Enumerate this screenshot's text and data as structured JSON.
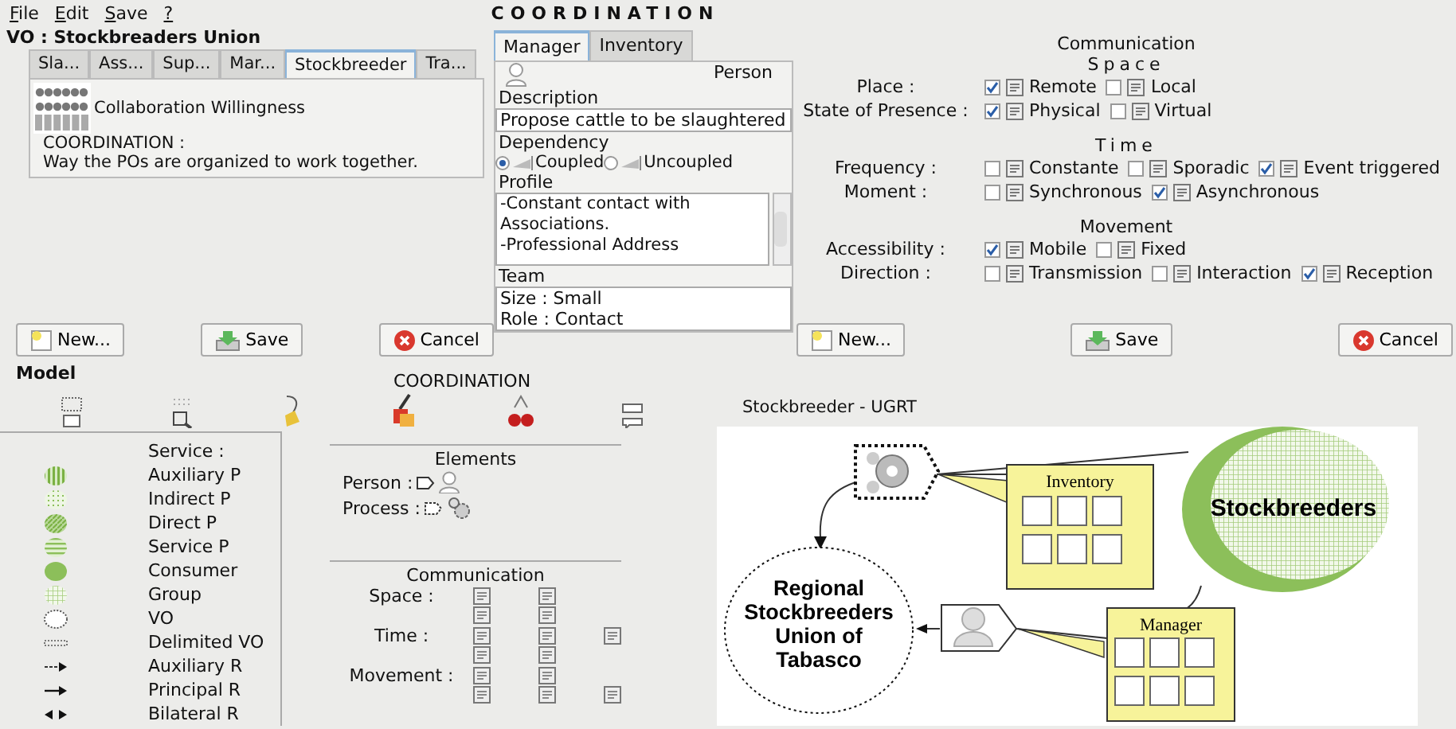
{
  "menu": [
    "File",
    "Edit",
    "Save",
    "?"
  ],
  "header_title": "COORDINATION",
  "vo_title": "VO : Stockbreaders Union",
  "vo_tabs": [
    {
      "label": "Sla...",
      "selected": false
    },
    {
      "label": "Ass...",
      "selected": false
    },
    {
      "label": "Sup...",
      "selected": false
    },
    {
      "label": "Mar...",
      "selected": false
    },
    {
      "label": "Stockbreeder",
      "selected": true
    },
    {
      "label": "Tra...",
      "selected": false
    }
  ],
  "aspect": {
    "title": "Collaboration Willingness",
    "heading": "COORDINATION :",
    "text": "Way the POs are organized to work together."
  },
  "left_buttons": [
    {
      "label": "New...",
      "kind": "new"
    },
    {
      "label": "Save",
      "kind": "save"
    },
    {
      "label": "Cancel",
      "kind": "cancel"
    }
  ],
  "role_tabs": [
    {
      "label": "Manager",
      "selected": true
    },
    {
      "label": "Inventory",
      "selected": false
    }
  ],
  "element_type": "Person",
  "description": {
    "label": "Description",
    "value": "Propose cattle to be slaughtered"
  },
  "dependency": {
    "label": "Dependency",
    "options": [
      {
        "label": "Coupled",
        "selected": true
      },
      {
        "label": "Uncoupled",
        "selected": false
      }
    ]
  },
  "profile": {
    "label": "Profile",
    "value": "-Constant contact with Associations.\n-Professional Address"
  },
  "team": {
    "label": "Team",
    "lines": [
      "Size : Small",
      "Role : Contact"
    ]
  },
  "communication": {
    "title": "Communication",
    "groups": [
      {
        "title": "Space",
        "spaced": true,
        "rows": [
          {
            "label": "Place :",
            "options": [
              {
                "label": "Remote",
                "checked": true
              },
              {
                "label": "Local",
                "checked": false
              }
            ]
          },
          {
            "label": "State of Presence :",
            "options": [
              {
                "label": "Physical",
                "checked": true
              },
              {
                "label": "Virtual",
                "checked": false
              }
            ]
          }
        ]
      },
      {
        "title": "Time",
        "spaced": true,
        "rows": [
          {
            "label": "Frequency :",
            "options": [
              {
                "label": "Constante",
                "checked": false
              },
              {
                "label": "Sporadic",
                "checked": false
              },
              {
                "label": "Event triggered",
                "checked": true
              }
            ]
          },
          {
            "label": "Moment :",
            "options": [
              {
                "label": "Synchronous",
                "checked": false
              },
              {
                "label": "Asynchronous",
                "checked": true
              }
            ]
          }
        ]
      },
      {
        "title": "Movement",
        "spaced": false,
        "rows": [
          {
            "label": "Accessibility :",
            "options": [
              {
                "label": "Mobile",
                "checked": true
              },
              {
                "label": "Fixed",
                "checked": false
              }
            ]
          },
          {
            "label": "Direction :",
            "options": [
              {
                "label": "Transmission",
                "checked": false
              },
              {
                "label": "Interaction",
                "checked": false
              },
              {
                "label": "Reception",
                "checked": true
              }
            ]
          }
        ]
      }
    ]
  },
  "right_buttons": [
    {
      "label": "New...",
      "kind": "new"
    },
    {
      "label": "Save",
      "kind": "save"
    },
    {
      "label": "Cancel",
      "kind": "cancel"
    }
  ],
  "model": {
    "title": "Model",
    "coordination_label": "COORDINATION",
    "legend_heading": "Service :",
    "legend": [
      {
        "label": "Auxiliary P",
        "kind": "vstripe"
      },
      {
        "label": "Indirect P",
        "kind": "dotted"
      },
      {
        "label": "Direct P",
        "kind": "diagonal"
      },
      {
        "label": "Service P",
        "kind": "hstripe"
      },
      {
        "label": "Consumer",
        "kind": "solid"
      },
      {
        "label": "Group",
        "kind": "grid"
      },
      {
        "label": "VO",
        "kind": "vo"
      },
      {
        "label": "Delimited VO",
        "kind": "delimited"
      },
      {
        "label": "Auxiliary R",
        "kind": "aux"
      },
      {
        "label": "Principal R",
        "kind": "principal"
      },
      {
        "label": "Bilateral R",
        "kind": "bilateral"
      }
    ],
    "elements_title": "Elements",
    "elements": [
      "Person :",
      "Process :"
    ],
    "comm_title": "Communication",
    "comm_rows": [
      {
        "label": "Space :"
      },
      {
        "label": "Time :"
      },
      {
        "label": "Movement :"
      }
    ]
  },
  "diagram": {
    "title": "Stockbreeder - UGRT",
    "org": [
      "Regional",
      "Stockbreeders",
      "Union of",
      "Tabasco"
    ],
    "group": "Stockbreeders",
    "callouts": [
      "Inventory",
      "Manager"
    ]
  }
}
